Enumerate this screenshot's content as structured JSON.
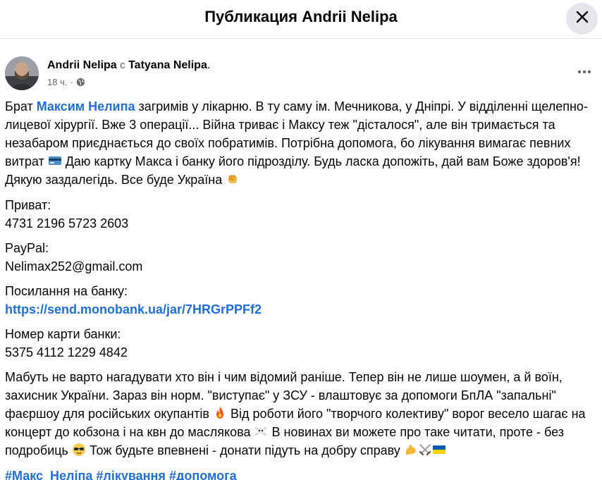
{
  "header": {
    "title": "Публикация Andrii Nelipa"
  },
  "post": {
    "author": "Andrii Nelipa",
    "with_word": "с",
    "tagged_person": "Tatyana Nelipa",
    "tagged_suffix": ".",
    "time": "18 ч.",
    "dot": "·",
    "paragraph1": {
      "t1": "Брат ",
      "mention": "Максим Нелипа",
      "t2": " загримів у лікарню. В ту саму ім. Мечникова, у Дніпрі. У відділенні щелепно-лицевої хірургії. Вже 3 операції... Війна триває і Максу теж \"дісталося\", але він тримається та незабаром приєднається до своїх побратимів. Потрібна допомога, бо лікування вимагає певних витрат ",
      "t3": " Даю  картку Макса і банку його підрозділу. Будь ласка допожіть, дай вам Боже здоров'я! Дякую заздалегідь. Все буде Україна "
    },
    "privat": {
      "label": "Приват:",
      "value": "4731 2196 5723 2603"
    },
    "paypal": {
      "label": "PayPal:",
      "value": "Nelimax252@gmail.com"
    },
    "bank_link": {
      "label": "Посилання на банку:",
      "value": "https://send.monobank.ua/jar/7HRGrPPFf2"
    },
    "bank_card": {
      "label": "Номер карти банки:",
      "value": "5375 4112 1229 4842"
    },
    "paragraph2": {
      "t1": "Мабуть не варто нагадувати хто він і чим відомий раніше. Тепер він не лише шоумен, а й воїн, захисник України. Зараз він норм. \"виступає\" у ЗСУ - влаштовує за допомоги БпЛА \"запальні\" фаєршоу для російських окупантів ",
      "t2": " Від роботи його \"творчого колективу\" ворог весело шагає на концерт до кобзона і на квн до маслякова ",
      "t3": " В новинах ви можете про таке читати, проте - без подробиць ",
      "t4": " Тож будьте впевнені - донати підуть на добру справу "
    },
    "hashtags": [
      "#Макс_Неліпа",
      "#лікування",
      "#допомога"
    ]
  },
  "icons": {
    "close": "close-icon",
    "globe": "globe-icon",
    "more": "more-horizontal-icon",
    "bank_card_emoji": "credit-card-emoji",
    "fist_emoji": "raised-fist-emoji",
    "fire_emoji": "fire-emoji",
    "skull_emoji": "skull-crossbones-emoji",
    "sunglasses_emoji": "sunglasses-face-emoji",
    "muscle_emoji": "flexed-biceps-emoji",
    "swords_emoji": "crossed-swords-emoji",
    "flag_emoji": "ukraine-flag-emoji"
  },
  "colors": {
    "link": "#216fdb",
    "text": "#050505",
    "secondary": "#65676b",
    "close_bg": "#e4e6eb"
  }
}
